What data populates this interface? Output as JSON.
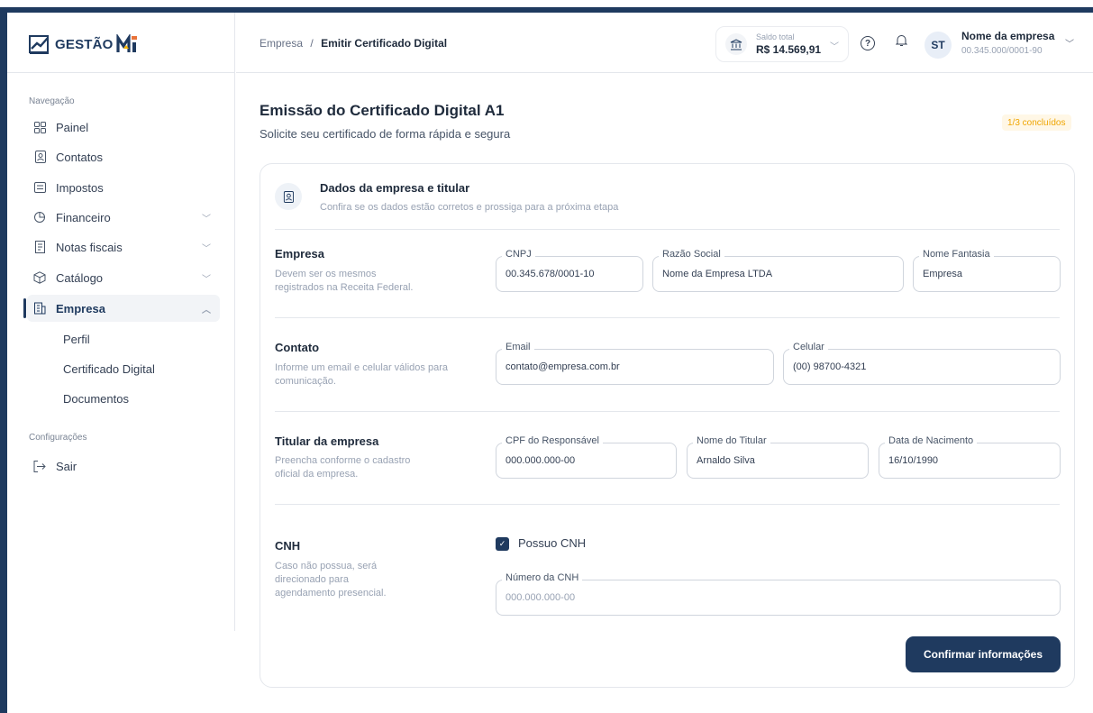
{
  "brand": {
    "logo_text": "GESTÃO",
    "logo_suffix": "MEI"
  },
  "sidebar": {
    "section_nav": "Navegação",
    "items": [
      {
        "label": "Painel",
        "icon": "grid-icon"
      },
      {
        "label": "Contatos",
        "icon": "contact-book-icon"
      },
      {
        "label": "Impostos",
        "icon": "receipt-icon"
      },
      {
        "label": "Financeiro",
        "icon": "finance-icon"
      },
      {
        "label": "Notas fiscais",
        "icon": "invoice-icon"
      },
      {
        "label": "Catálogo",
        "icon": "box-icon"
      },
      {
        "label": "Empresa",
        "icon": "building-icon"
      }
    ],
    "sub_items": [
      "Perfil",
      "Certificado Digital",
      "Documentos"
    ],
    "section_config": "Configurações",
    "logout": "Sair"
  },
  "header": {
    "breadcrumb_parent": "Empresa",
    "breadcrumb_sep": "/",
    "breadcrumb_current": "Emitir Certificado Digital",
    "balance_label": "Saldo total",
    "balance_value": "R$ 14.569,91",
    "avatar_initials": "ST",
    "company_name": "Nome da empresa",
    "company_cnpj": "00.345.000/0001-90"
  },
  "main": {
    "title": "Emissão do Certificado Digital A1",
    "subtitle": "Solicite seu certificado de forma rápida e segura",
    "progress": "1/3 concluídos",
    "card_title": "Dados da empresa e titular",
    "card_subtitle": "Confira se os dados estão corretos e prossiga para a próxima etapa",
    "sections": {
      "empresa": {
        "title": "Empresa",
        "desc": "Devem ser os mesmos registrados na Receita Federal.",
        "cnpj_label": "CNPJ",
        "cnpj_value": "00.345.678/0001-10",
        "razao_label": "Razão Social",
        "razao_value": "Nome da Empresa LTDA",
        "fantasia_label": "Nome Fantasia",
        "fantasia_value": "Empresa"
      },
      "contato": {
        "title": "Contato",
        "desc": "Informe um email e celular válidos para comunicação.",
        "email_label": "Email",
        "email_value": "contato@empresa.com.br",
        "celular_label": "Celular",
        "celular_value": "(00) 98700-4321"
      },
      "titular": {
        "title": "Titular da empresa",
        "desc": "Preencha conforme o cadastro oficial da empresa.",
        "cpf_label": "CPF do Responsável",
        "cpf_value": "000.000.000-00",
        "nome_label": "Nome do Titular",
        "nome_value": "Arnaldo Silva",
        "nasc_label": "Data de Nacimento",
        "nasc_value": "16/10/1990"
      },
      "cnh": {
        "title": "CNH",
        "desc": "Caso não possua, será direcionado para agendamento presencial.",
        "checkbox_label": "Possuo CNH",
        "checked": true,
        "numero_label": "Número da CNH",
        "numero_placeholder": "000.000.000-00"
      }
    },
    "confirm_button": "Confirmar informações"
  },
  "colors": {
    "primary": "#1f3a5f",
    "accent_badge": "#f0a500"
  }
}
